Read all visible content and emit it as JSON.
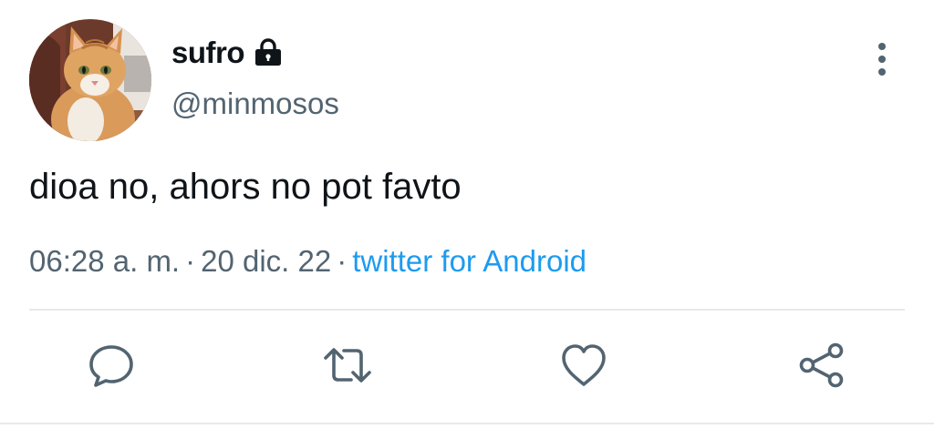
{
  "user": {
    "display_name": "sufro",
    "handle": "@minmosos",
    "avatar": "orange-tabby-cat-avatar",
    "protected_icon": "lock-icon"
  },
  "tweet": {
    "text": "dioa no, ahors no pot favto",
    "time": "06:28 a. m.",
    "separator": "·",
    "date": "20 dic. 22",
    "source": "twitter for Android"
  },
  "actions": [
    {
      "name": "reply",
      "icon": "comment-icon"
    },
    {
      "name": "retweet",
      "icon": "retweet-icon"
    },
    {
      "name": "like",
      "icon": "heart-icon"
    },
    {
      "name": "share",
      "icon": "share-icon"
    }
  ],
  "menu_icon": "more-vertical-icon",
  "colors": {
    "text": "#0f1419",
    "muted": "#536471",
    "link": "#1d9bf0",
    "divider": "#e7e9ea"
  }
}
